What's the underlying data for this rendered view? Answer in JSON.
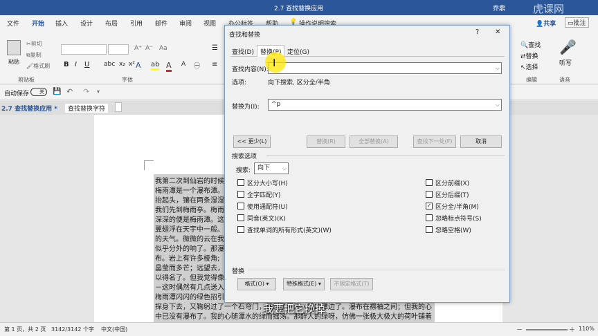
{
  "window": {
    "title": "2.7 查找替换应用",
    "user": "乔鼎"
  },
  "ribbon_tabs": [
    "文件",
    "开始",
    "插入",
    "设计",
    "布局",
    "引用",
    "邮件",
    "审阅",
    "视图",
    "办公标签",
    "帮助"
  ],
  "tell_me": "操作说明搜索",
  "share": "共享",
  "comment": "批注",
  "groups": {
    "clipboard": "剪贴板",
    "font": "字体",
    "editing": "编辑",
    "voice": "语音"
  },
  "clipboard": {
    "paste": "粘贴",
    "cut": "剪切",
    "copy": "复制",
    "painter": "格式刷"
  },
  "editing": {
    "find": "查找",
    "replace": "替换",
    "select": "选择"
  },
  "voice": {
    "dictate": "听写"
  },
  "qat": {
    "autosave_label": "自动保存",
    "autosave_state": "关"
  },
  "doc_tabs": [
    "2.7 查找替换应用 *",
    "查找替换字符"
  ],
  "document_lines": [
    "我第二次到仙岩的时候",
    "梅雨潭是一个瀑布潭。",
    "抬起头，镶在两条湿湿",
    "我们先到梅雨亭。梅雨",
    "深深的便是梅雨潭。这",
    "翼翅浮在天宇中一般。",
    "的天气。微微的云在我",
    "似乎分外的响了。那瀑",
    "布。岩上有许多棱角;",
    "晶莹而多芒；远望去，",
    "以得名了。但我觉得像",
    "－这时偶然有几点送入",
    "梅雨潭闪闪的绿色招引",
    "探身下去，又鞠躬过了一个石穹门，便到了汪汪一碧的潭边了。瀑布在襟袖之间；但我的心",
    "中已没有瀑布了。我的心随潭水的绿而摇荡。那醉人的绿呀，仿佛一张极大极大的荷叶铺着"
  ],
  "status": {
    "page": "第 1 页，共 2 页",
    "words": "3142/3142 个字",
    "lang": "中文(中国)",
    "zoom": "110%"
  },
  "dialog": {
    "title": "查找和替换",
    "help": "?",
    "close": "✕",
    "tabs": [
      "查找(D)",
      "替换(P)",
      "定位(G)"
    ],
    "active_tab": 1,
    "find_label": "查找内容(N):",
    "find_value": "",
    "options_label": "选项:",
    "options_value": "向下搜索, 区分全/半角",
    "replace_label": "替换为(I):",
    "replace_value": "^p",
    "buttons": {
      "less": "<< 更少(L)",
      "replace": "替换(R)",
      "replace_all": "全部替换(A)",
      "find_next": "查找下一处(F)",
      "cancel": "取消"
    },
    "search_options_title": "搜索选项",
    "search_label": "搜索:",
    "search_value": "向下",
    "left_options": [
      {
        "label": "区分大小写(H)",
        "checked": false
      },
      {
        "label": "全字匹配(Y)",
        "checked": false
      },
      {
        "label": "使用通配符(U)",
        "checked": false
      },
      {
        "label": "同音(英文)(K)",
        "checked": false
      },
      {
        "label": "查找单词的所有形式(英文)(W)",
        "checked": false
      }
    ],
    "right_options": [
      {
        "label": "区分前缀(X)",
        "checked": false
      },
      {
        "label": "区分后缀(T)",
        "checked": false
      },
      {
        "label": "区分全/半角(M)",
        "checked": true
      },
      {
        "label": "忽略标点符号(S)",
        "checked": false
      },
      {
        "label": "忽略空格(W)",
        "checked": false
      }
    ],
    "replace_section": "替换",
    "format_btn": "格式(O) ▾",
    "special_btn": "特殊格式(E) ▾",
    "no_format_btn": "不限定格式(T)"
  },
  "subtitle": "我要把它换掉",
  "watermark": "虎课网"
}
